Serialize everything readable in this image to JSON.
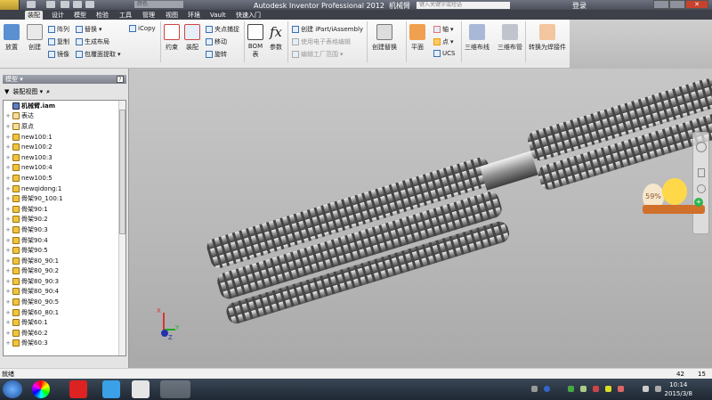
{
  "title": {
    "app": "Autodesk Inventor Professional 2012",
    "doc": "机械臂",
    "search_placeholder": "键入关键字或短语",
    "login": "登录",
    "style": "颜色"
  },
  "tabs": [
    "装配",
    "设计",
    "模型",
    "检验",
    "工具",
    "管理",
    "视图",
    "环境",
    "Vault",
    "快速入门"
  ],
  "ribbon": {
    "place": "放置",
    "create": "创建",
    "pattern": "阵列",
    "copy": "复制",
    "mirror": "镜像",
    "replace": "替换",
    "make_layout": "生成布局",
    "shrinkwrap": "包覆面提取",
    "icopy": "iCopy",
    "constrain": "约束",
    "assemble": "装配",
    "grip_snap": "夹点捕捉",
    "move": "移动",
    "rotate": "旋转",
    "bom": "BOM 表",
    "params": "参数",
    "create_ipart": "创建 iPart/iAssembly",
    "spreadsheet": "使用电子表格编辑",
    "edit_factory": "编辑工厂范围",
    "create_sub": "创建替换",
    "plane": "平面",
    "axis": "轴",
    "point": "点",
    "ucs": "UCS",
    "cable": "三维布线",
    "tube": "三维布管",
    "weldment": "转换为焊接件"
  },
  "panel": {
    "title": "模型",
    "view": "装配视图",
    "tree": [
      {
        "label": "机械臂.iam",
        "type": "root"
      },
      {
        "label": "表达",
        "type": "folder"
      },
      {
        "label": "原点",
        "type": "folder"
      },
      {
        "label": "new100:1",
        "type": "part"
      },
      {
        "label": "new100:2",
        "type": "part"
      },
      {
        "label": "new100:3",
        "type": "part"
      },
      {
        "label": "new100:4",
        "type": "part"
      },
      {
        "label": "new100:5",
        "type": "part"
      },
      {
        "label": "newqidong:1",
        "type": "part"
      },
      {
        "label": "骨架90_100:1",
        "type": "part"
      },
      {
        "label": "骨架90:1",
        "type": "part"
      },
      {
        "label": "骨架90:2",
        "type": "part"
      },
      {
        "label": "骨架90:3",
        "type": "part"
      },
      {
        "label": "骨架90:4",
        "type": "part"
      },
      {
        "label": "骨架90:5",
        "type": "part"
      },
      {
        "label": "骨架80_90:1",
        "type": "part"
      },
      {
        "label": "骨架80_90:2",
        "type": "part"
      },
      {
        "label": "骨架80_90:3",
        "type": "part"
      },
      {
        "label": "骨架80_90:4",
        "type": "part"
      },
      {
        "label": "骨架80_90:5",
        "type": "part"
      },
      {
        "label": "骨架60_80:1",
        "type": "part"
      },
      {
        "label": "骨架60:1",
        "type": "part"
      },
      {
        "label": "骨架60:2",
        "type": "part"
      },
      {
        "label": "骨架60:3",
        "type": "part"
      }
    ]
  },
  "status": {
    "text": "就绪",
    "num1": "42",
    "num2": "15"
  },
  "widget": {
    "percent": "59%"
  },
  "clock": {
    "time": "10:14",
    "date": "2015/3/8"
  },
  "axes": {
    "x": "X",
    "y": "Y",
    "z": "Z"
  }
}
